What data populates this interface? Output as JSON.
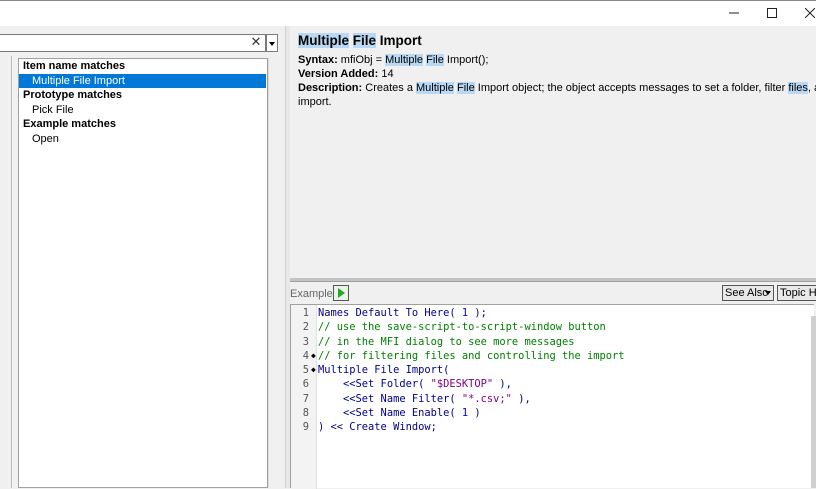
{
  "window": {
    "minimize_icon": "minimize-icon",
    "maximize_icon": "maximize-icon",
    "close_icon": "close-icon"
  },
  "search": {
    "value": "",
    "clear_glyph": "✕"
  },
  "results": {
    "groups": [
      {
        "header": "Item name matches",
        "items": [
          "Multiple File Import"
        ]
      },
      {
        "header": "Prototype matches",
        "items": [
          "Pick File"
        ]
      },
      {
        "header": "Example matches",
        "items": [
          "Open"
        ]
      }
    ],
    "selected": "Multiple File Import"
  },
  "doc": {
    "title_hl1": "Multiple",
    "title_mid": " ",
    "title_hl2": "File",
    "title_rest": " Import",
    "syntax_label": "Syntax:",
    "syntax_pre": " mfiObj = ",
    "syntax_hl1": "Multiple",
    "syntax_sp": " ",
    "syntax_hl2": "File",
    "syntax_post": " Import();",
    "version_label": "Version Added:",
    "version_value": " 14",
    "desc_label": "Description:",
    "desc_pre": " Creates a ",
    "desc_hl1": "Multiple",
    "desc_sp": " ",
    "desc_hl2": "File",
    "desc_mid": " Import object; the object accepts messages to set a folder, filter ",
    "desc_hl3": "files",
    "desc_post": ", and",
    "desc_line2": "import."
  },
  "example": {
    "label": "Example",
    "see_also": "See Also",
    "topic_help": "Topic He",
    "lines": [
      {
        "n": "1",
        "mark": "",
        "parts": [
          [
            "kw",
            "Names Default To Here( "
          ],
          [
            "num",
            "1"
          ],
          [
            "kw",
            " );"
          ]
        ]
      },
      {
        "n": "2",
        "mark": "",
        "parts": [
          [
            "cm",
            "// use the save-script-to-script-window button"
          ]
        ]
      },
      {
        "n": "3",
        "mark": "",
        "parts": [
          [
            "cm",
            "// in the MFI dialog to see more messages"
          ]
        ]
      },
      {
        "n": "4",
        "mark": "◆",
        "parts": [
          [
            "cm",
            "// for filtering files and controlling the import"
          ]
        ]
      },
      {
        "n": "5",
        "mark": "◆",
        "parts": [
          [
            "kw",
            "Multiple File Import("
          ]
        ]
      },
      {
        "n": "6",
        "mark": "",
        "parts": [
          [
            "kw",
            "    <<Set Folder( "
          ],
          [
            "str",
            "\"$DESKTOP\""
          ],
          [
            "kw",
            " ),"
          ]
        ]
      },
      {
        "n": "7",
        "mark": "",
        "parts": [
          [
            "kw",
            "    <<Set Name Filter( "
          ],
          [
            "str",
            "\"*.csv;\""
          ],
          [
            "kw",
            " ),"
          ]
        ]
      },
      {
        "n": "8",
        "mark": "",
        "parts": [
          [
            "kw",
            "    <<Set Name Enable( "
          ],
          [
            "num",
            "1"
          ],
          [
            "kw",
            " )"
          ]
        ]
      },
      {
        "n": "9",
        "mark": "",
        "parts": [
          [
            "kw",
            ") << Create Window;"
          ]
        ]
      }
    ]
  }
}
